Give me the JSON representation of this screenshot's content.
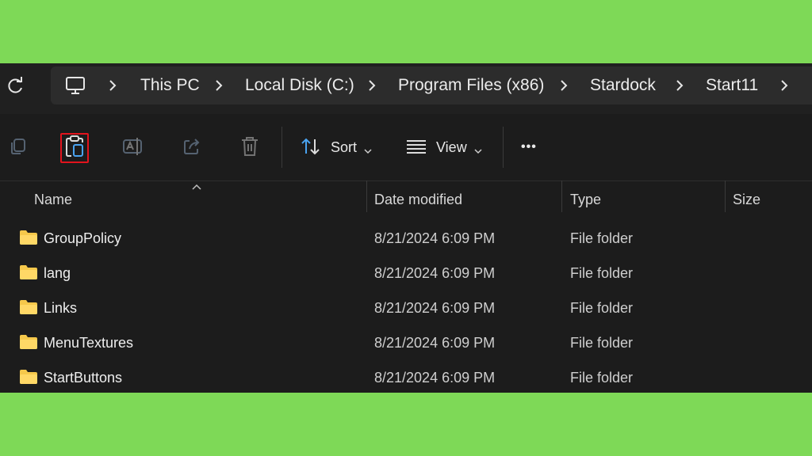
{
  "breadcrumb": [
    "This PC",
    "Local Disk (C:)",
    "Program Files (x86)",
    "Stardock",
    "Start11"
  ],
  "toolbar": {
    "sort_label": "Sort",
    "view_label": "View",
    "more_label": "•••"
  },
  "columns": {
    "name": "Name",
    "date": "Date modified",
    "type": "Type",
    "size": "Size"
  },
  "files": [
    {
      "name": "GroupPolicy",
      "date": "8/21/2024 6:09 PM",
      "type": "File folder"
    },
    {
      "name": "lang",
      "date": "8/21/2024 6:09 PM",
      "type": "File folder"
    },
    {
      "name": "Links",
      "date": "8/21/2024 6:09 PM",
      "type": "File folder"
    },
    {
      "name": "MenuTextures",
      "date": "8/21/2024 6:09 PM",
      "type": "File folder"
    },
    {
      "name": "StartButtons",
      "date": "8/21/2024 6:09 PM",
      "type": "File folder"
    }
  ],
  "colors": {
    "background_band": "#7ed957",
    "window": "#1c1c1c",
    "highlight": "#e2141d",
    "folder": "#f5c84b",
    "accent": "#4aa3f0"
  }
}
